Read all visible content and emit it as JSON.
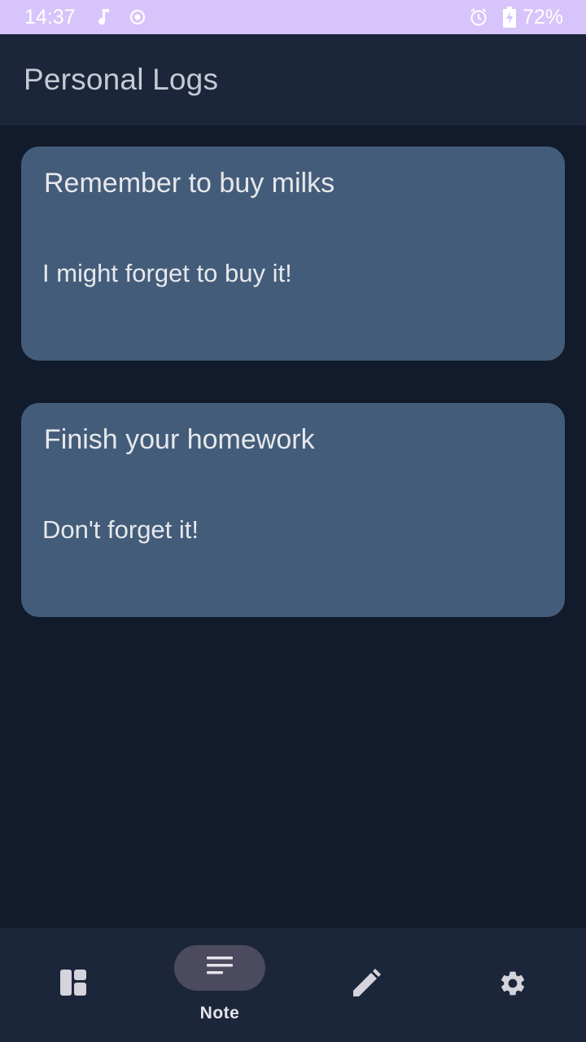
{
  "status_bar": {
    "time": "14:37",
    "battery": "72%",
    "icons": [
      "music-note-icon",
      "record-icon",
      "alarm-icon",
      "battery-charging-icon"
    ]
  },
  "app_bar": {
    "title": "Personal Logs"
  },
  "notes": [
    {
      "title": "Remember to buy milks",
      "body": "I might forget to buy it!"
    },
    {
      "title": "Finish your homework",
      "body": "Don't forget it!"
    }
  ],
  "bottom_nav": {
    "items": [
      {
        "icon": "dashboard-icon",
        "label": ""
      },
      {
        "icon": "notes-icon",
        "label": "Note",
        "active": true
      },
      {
        "icon": "edit-pencil-icon",
        "label": ""
      },
      {
        "icon": "settings-gear-icon",
        "label": ""
      }
    ]
  },
  "colors": {
    "status_bar_bg": "#d7c4fa",
    "app_bar_bg": "#1c263b",
    "screen_bg": "#111b2b",
    "card_bg": "#435c79",
    "active_pill": "#4b4a5f"
  }
}
